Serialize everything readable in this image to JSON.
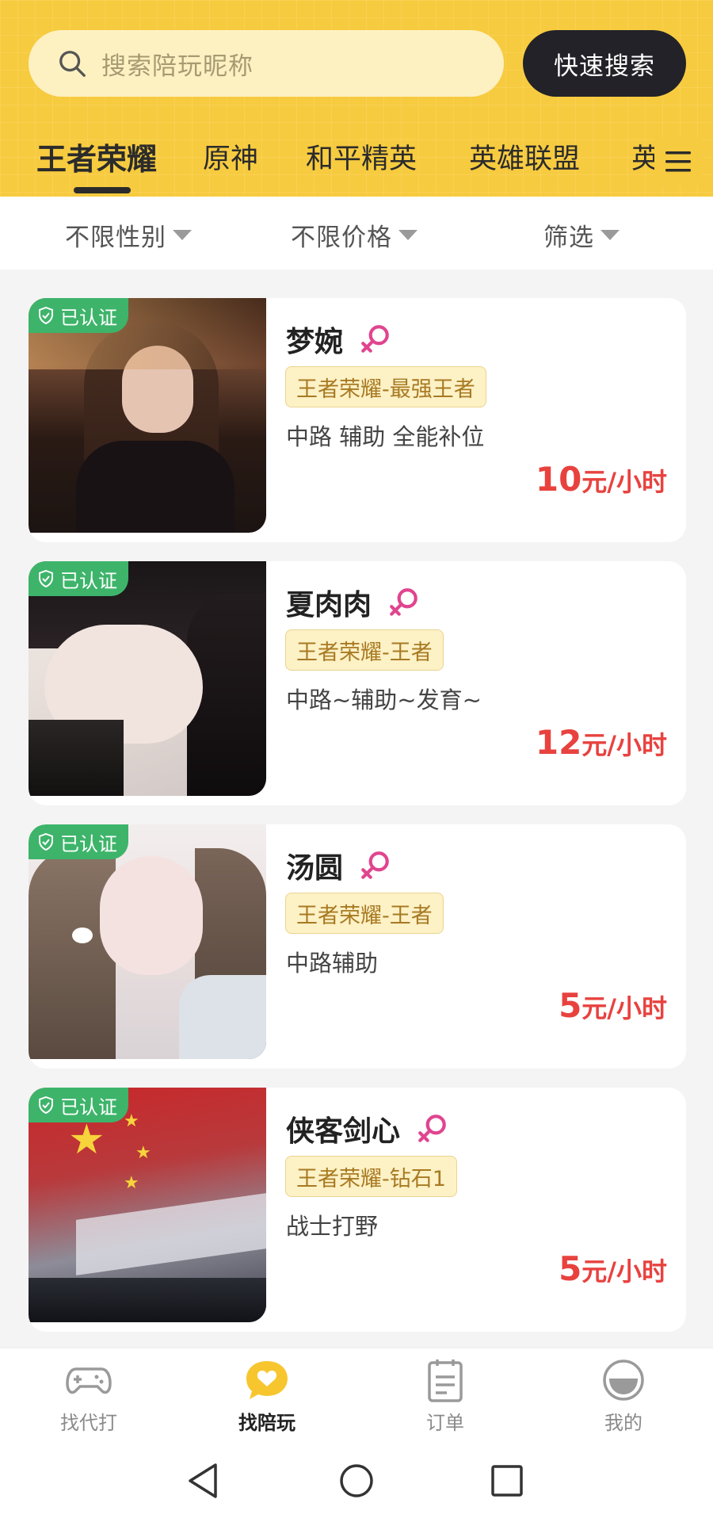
{
  "search": {
    "placeholder": "搜索陪玩昵称",
    "button_label": "快速搜索"
  },
  "tabs": [
    {
      "label": "王者荣耀",
      "active": true
    },
    {
      "label": "原神",
      "active": false
    },
    {
      "label": "和平精英",
      "active": false
    },
    {
      "label": "英雄联盟",
      "active": false
    },
    {
      "label": "英",
      "active": false
    }
  ],
  "filters": [
    {
      "label": "不限性别"
    },
    {
      "label": "不限价格"
    },
    {
      "label": "筛选"
    }
  ],
  "cards": [
    {
      "verified_label": "已认证",
      "name": "梦婉",
      "rank": "王者荣耀-最强王者",
      "desc": "中路 辅助 全能补位",
      "price": "10",
      "unit": "元/小时"
    },
    {
      "verified_label": "已认证",
      "name": "夏肉肉",
      "rank": "王者荣耀-王者",
      "desc": "中路~辅助~发育~",
      "price": "12",
      "unit": "元/小时"
    },
    {
      "verified_label": "已认证",
      "name": "汤圆",
      "rank": "王者荣耀-王者",
      "desc": "中路辅助",
      "price": "5",
      "unit": "元/小时"
    },
    {
      "verified_label": "已认证",
      "name": "侠客剑心",
      "rank": "王者荣耀-钻石1",
      "desc": "战士打野",
      "price": "5",
      "unit": "元/小时"
    }
  ],
  "bottom_nav": [
    {
      "label": "找代打",
      "icon": "gamepad-icon",
      "active": false
    },
    {
      "label": "找陪玩",
      "icon": "chat-heart-icon",
      "active": true
    },
    {
      "label": "订单",
      "icon": "order-list-icon",
      "active": false
    },
    {
      "label": "我的",
      "icon": "profile-icon",
      "active": false
    }
  ],
  "colors": {
    "header_yellow": "#f7cb3f",
    "price_red": "#e8423f",
    "verified_green": "#3db46a",
    "female_pink": "#e0458f"
  }
}
